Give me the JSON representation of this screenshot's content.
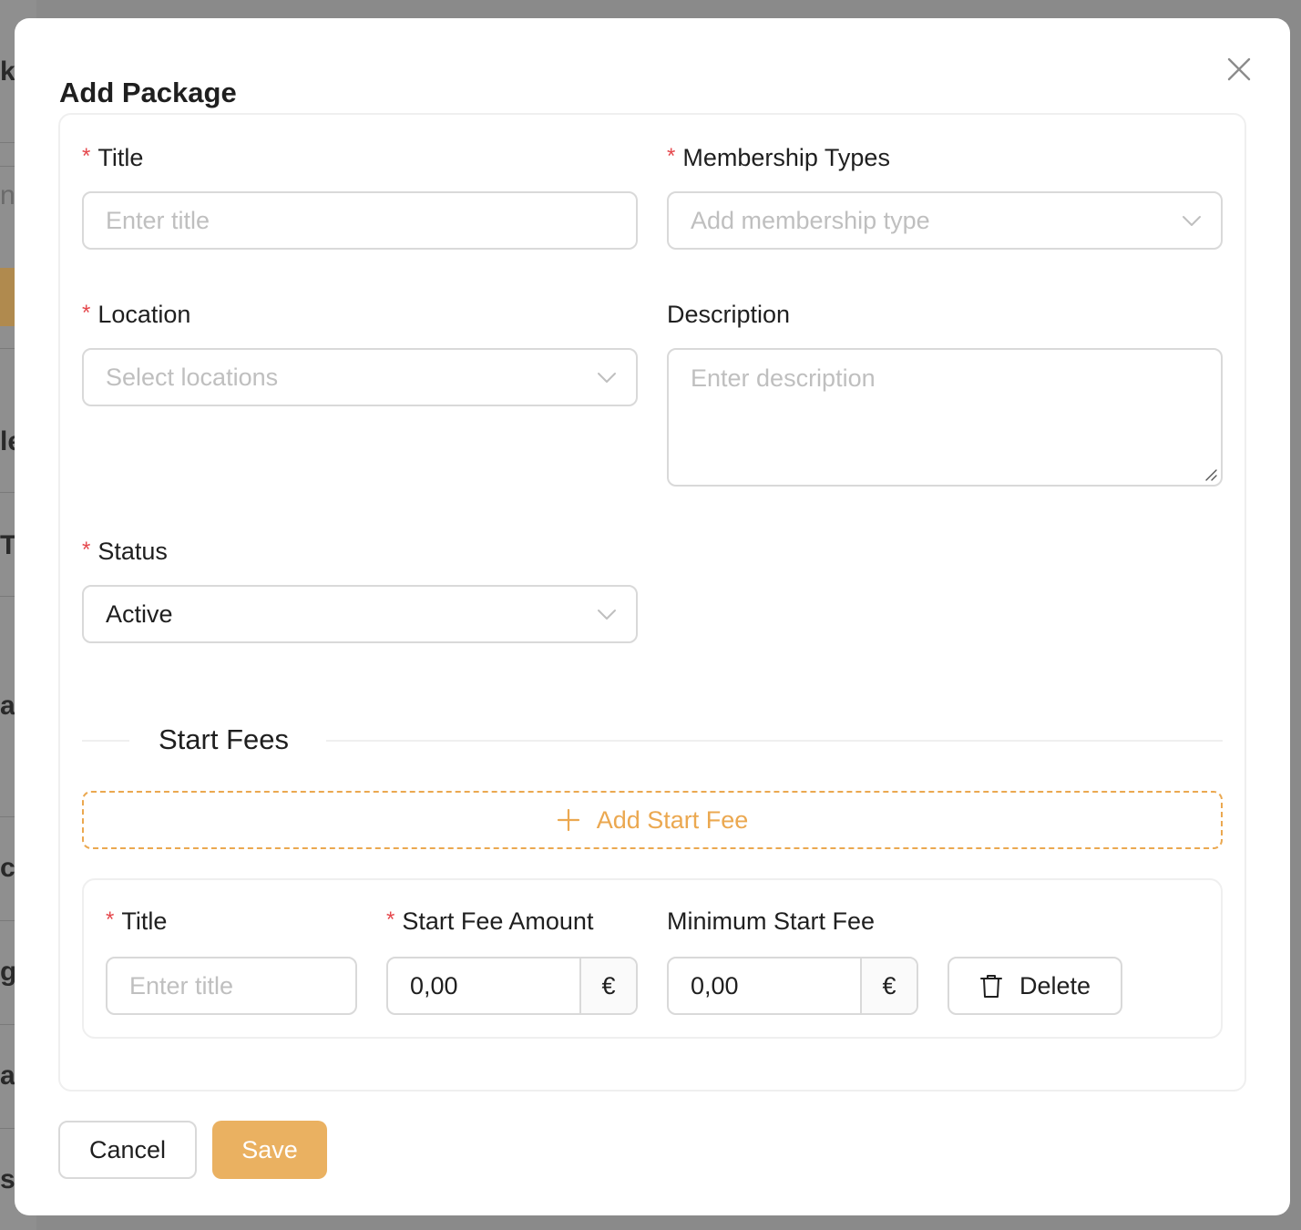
{
  "background": {
    "fragments": [
      "k",
      "n",
      "le",
      "T",
      "a",
      "c",
      "g",
      "ai",
      "st"
    ]
  },
  "modal": {
    "title": "Add Package",
    "close_icon": "close-icon"
  },
  "form": {
    "title": {
      "label": "Title",
      "placeholder": "Enter title",
      "required": true
    },
    "membership_types": {
      "label": "Membership Types",
      "placeholder": "Add membership type",
      "required": true
    },
    "location": {
      "label": "Location",
      "placeholder": "Select locations",
      "required": true
    },
    "description": {
      "label": "Description",
      "placeholder": "Enter description",
      "required": false
    },
    "status": {
      "label": "Status",
      "value": "Active",
      "required": true
    },
    "required_mark": "*"
  },
  "start_fees": {
    "section_title": "Start Fees",
    "add_label": "Add Start Fee",
    "item": {
      "title_label": "Title",
      "title_placeholder": "Enter title",
      "amount_label": "Start Fee Amount",
      "amount_value": "0,00",
      "min_label": "Minimum Start Fee",
      "min_value": "0,00",
      "currency": "€",
      "delete_label": "Delete"
    }
  },
  "footer": {
    "cancel_label": "Cancel",
    "save_label": "Save"
  },
  "colors": {
    "accent": "#eba850",
    "primary_button": "#eab161",
    "required": "#e5484d",
    "border": "#d9d9d9",
    "overlay": "#8a8a8a"
  }
}
